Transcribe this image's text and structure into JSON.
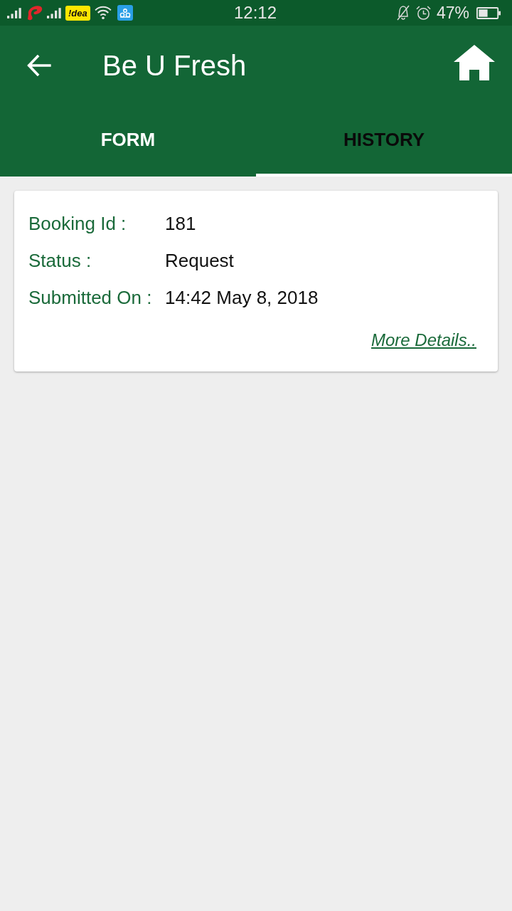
{
  "status_bar": {
    "carrier_badge": "!dea",
    "time": "12:12",
    "battery": "47%"
  },
  "app_bar": {
    "title": "Be U Fresh"
  },
  "tabs": [
    {
      "label": "FORM",
      "selected": false
    },
    {
      "label": "HISTORY",
      "selected": true
    }
  ],
  "bookings": [
    {
      "fields": [
        {
          "label": "Booking Id :",
          "value": "181"
        },
        {
          "label": "Status :",
          "value": "Request"
        },
        {
          "label": "Submitted On :",
          "value": "14:42 May 8, 2018"
        }
      ],
      "link": "More Details.."
    }
  ]
}
